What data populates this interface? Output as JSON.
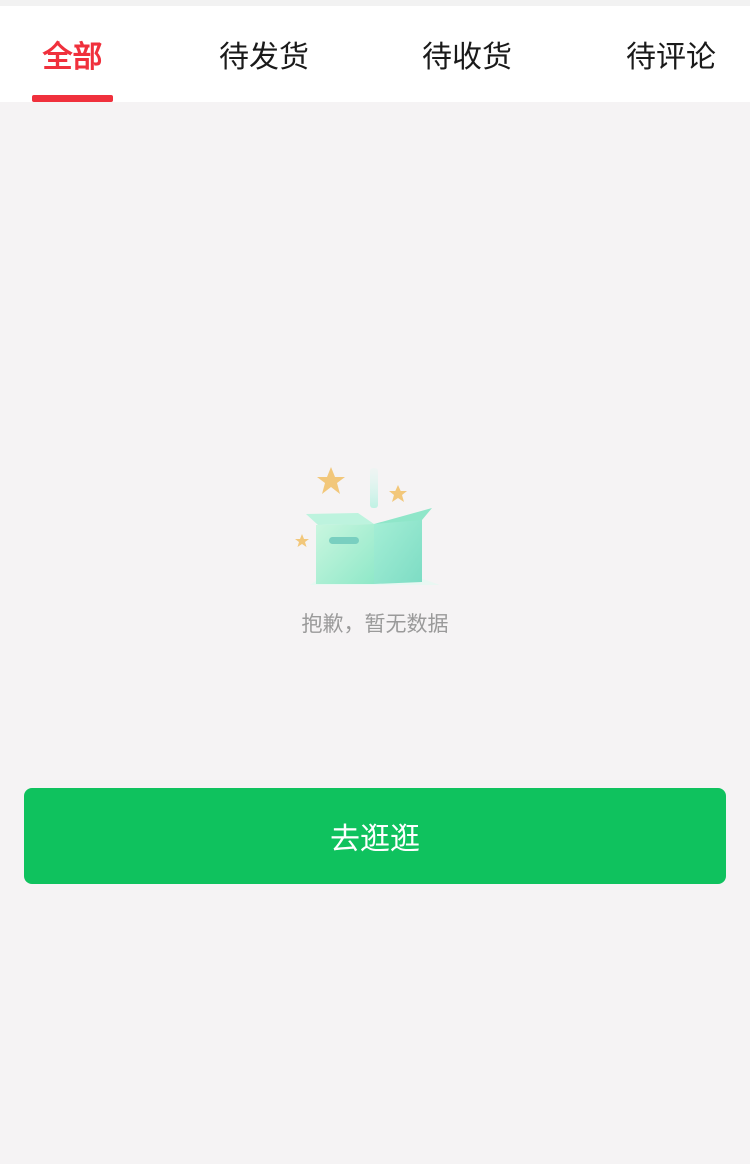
{
  "tabs": [
    {
      "label": "全部",
      "active": true
    },
    {
      "label": "待发货",
      "active": false
    },
    {
      "label": "待收货",
      "active": false
    },
    {
      "label": "待评论",
      "active": false
    }
  ],
  "empty_state": {
    "icon": "empty-box-icon",
    "message": "抱歉，暂无数据"
  },
  "action_button": {
    "label": "去逛逛"
  },
  "colors": {
    "accent": "#f0303c",
    "button": "#0fc25e",
    "background": "#f5f3f4"
  }
}
